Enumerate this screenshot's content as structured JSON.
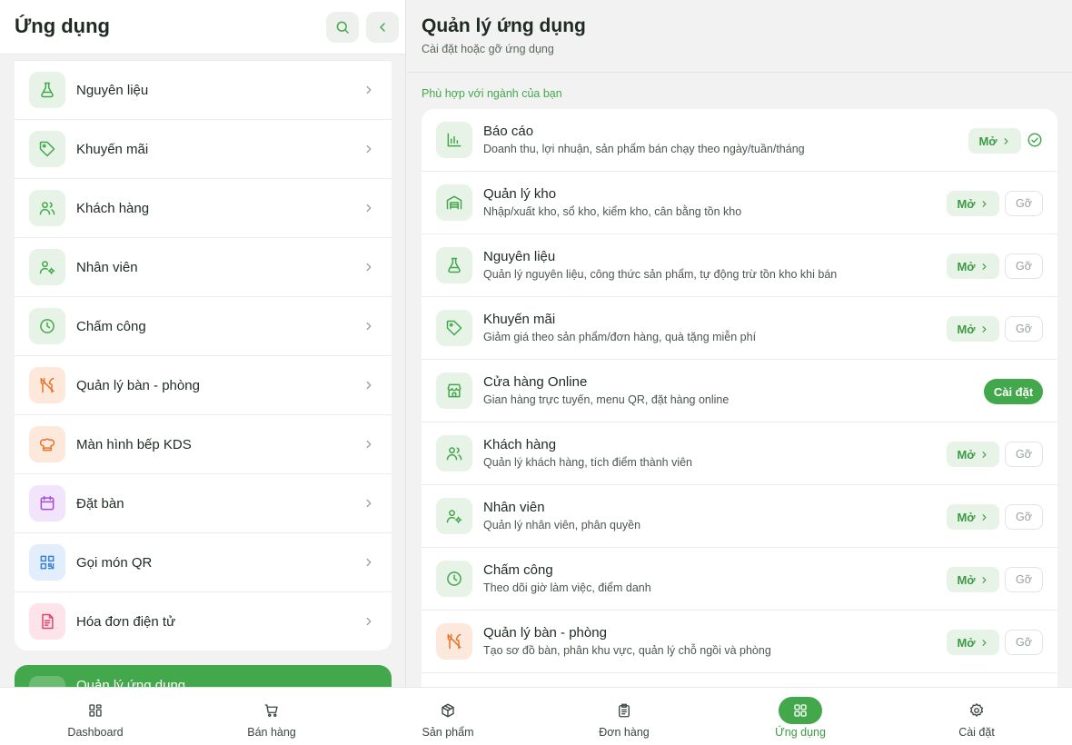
{
  "left_panel": {
    "title": "Ứng dụng",
    "items": [
      {
        "label": "Nguyên liệu",
        "icon": "flask-icon",
        "tint": "#e6f3e6",
        "color": "#43a84c"
      },
      {
        "label": "Khuyến mãi",
        "icon": "tag-icon",
        "tint": "#e6f3e6",
        "color": "#43a84c"
      },
      {
        "label": "Khách hàng",
        "icon": "users-icon",
        "tint": "#e6f3e6",
        "color": "#43a84c"
      },
      {
        "label": "Nhân viên",
        "icon": "user-gear-icon",
        "tint": "#e6f3e6",
        "color": "#43a84c"
      },
      {
        "label": "Chấm công",
        "icon": "clock-icon",
        "tint": "#e6f3e6",
        "color": "#43a84c"
      },
      {
        "label": "Quản lý bàn - phòng",
        "icon": "utensils-icon",
        "tint": "#fde9dc",
        "color": "#e8742a"
      },
      {
        "label": "Màn hình bếp KDS",
        "icon": "chef-hat-icon",
        "tint": "#fde9dc",
        "color": "#e8742a"
      },
      {
        "label": "Đặt bàn",
        "icon": "calendar-icon",
        "tint": "#f2e4fb",
        "color": "#a64fd6"
      },
      {
        "label": "Gọi món QR",
        "icon": "qr-code-icon",
        "tint": "#e2eefc",
        "color": "#3b82d6"
      },
      {
        "label": "Hóa đơn điện tử",
        "icon": "invoice-icon",
        "tint": "#fde4ea",
        "color": "#e0466d"
      }
    ],
    "active_item": {
      "label": "Quản lý ứng dụng"
    }
  },
  "right_panel": {
    "title": "Quản lý ứng dụng",
    "subtitle": "Cài đặt hoặc gỡ ứng dụng",
    "section_label": "Phù hợp với ngành của bạn",
    "open_label": "Mở",
    "remove_label": "Gỡ",
    "install_label": "Cài đặt",
    "apps": [
      {
        "name": "Báo cáo",
        "desc": "Doanh thu, lợi nhuận, sản phẩm bán chạy theo ngày/tuần/tháng",
        "icon": "bar-chart-icon",
        "tint": "#e6f3e6",
        "color": "#43a84c",
        "state": "default"
      },
      {
        "name": "Quản lý kho",
        "desc": "Nhập/xuất kho, sổ kho, kiểm kho, cân bằng tồn kho",
        "icon": "warehouse-icon",
        "tint": "#e6f3e6",
        "color": "#43a84c",
        "state": "installed"
      },
      {
        "name": "Nguyên liệu",
        "desc": "Quản lý nguyên liệu, công thức sản phẩm, tự động trừ tồn kho khi bán",
        "icon": "flask-icon",
        "tint": "#e6f3e6",
        "color": "#43a84c",
        "state": "installed"
      },
      {
        "name": "Khuyến mãi",
        "desc": "Giảm giá theo sản phẩm/đơn hàng, quà tặng miễn phí",
        "icon": "tag-icon",
        "tint": "#e6f3e6",
        "color": "#43a84c",
        "state": "installed"
      },
      {
        "name": "Cửa hàng Online",
        "desc": "Gian hàng trực tuyến, menu QR, đặt hàng online",
        "icon": "store-icon",
        "tint": "#e6f3e6",
        "color": "#43a84c",
        "state": "available"
      },
      {
        "name": "Khách hàng",
        "desc": "Quản lý khách hàng, tích điểm thành viên",
        "icon": "users-icon",
        "tint": "#e6f3e6",
        "color": "#43a84c",
        "state": "installed"
      },
      {
        "name": "Nhân viên",
        "desc": "Quản lý nhân viên, phân quyền",
        "icon": "user-gear-icon",
        "tint": "#e6f3e6",
        "color": "#43a84c",
        "state": "installed"
      },
      {
        "name": "Chấm công",
        "desc": "Theo dõi giờ làm việc, điểm danh",
        "icon": "clock-icon",
        "tint": "#e6f3e6",
        "color": "#43a84c",
        "state": "installed"
      },
      {
        "name": "Quản lý bàn - phòng",
        "desc": "Tạo sơ đồ bàn, phân khu vực, quản lý chỗ ngồi và phòng",
        "icon": "utensils-icon",
        "tint": "#fde9dc",
        "color": "#e8742a",
        "state": "installed"
      }
    ]
  },
  "bottom_nav": [
    {
      "label": "Dashboard",
      "icon": "dashboard-icon",
      "active": false
    },
    {
      "label": "Bán hàng",
      "icon": "cart-icon",
      "active": false
    },
    {
      "label": "Sản phẩm",
      "icon": "box-icon",
      "active": false
    },
    {
      "label": "Đơn hàng",
      "icon": "clipboard-icon",
      "active": false
    },
    {
      "label": "Ứng dụng",
      "icon": "apps-grid-icon",
      "active": true
    },
    {
      "label": "Cài đặt",
      "icon": "settings-gear-icon",
      "active": false
    }
  ],
  "colors": {
    "accent": "#43a84c",
    "accent_soft": "#e6f3e6"
  }
}
